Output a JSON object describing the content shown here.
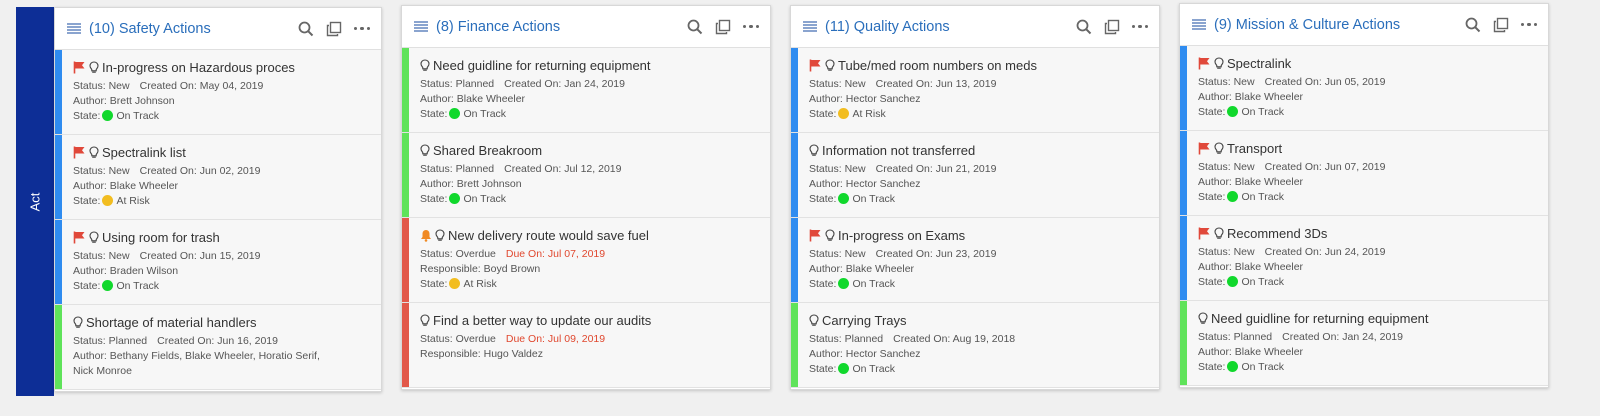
{
  "act_label": "Act",
  "colors": {
    "act_band": "#0d2e96",
    "title_blue": "#2a6ebb",
    "bar_blue": "#2f8cf0",
    "bar_green": "#5fe35a",
    "bar_red": "#e2584a",
    "flag_red": "#e0483a",
    "bell_orange": "#f08a24",
    "state_green": "#10d82c",
    "state_yellow": "#f2bd20",
    "overdue_red": "#e0482f"
  },
  "labels": {
    "status": "Status:",
    "created_on": "Created On:",
    "due_on": "Due On:",
    "author": "Author:",
    "responsible": "Responsible:",
    "state": "State:"
  },
  "boards": [
    {
      "title": "(10) Safety Actions",
      "cards": [
        {
          "title": "In-progress on Hazardous proces",
          "flag": true,
          "bar": "blue",
          "status": "New",
          "created": "May 04, 2019",
          "author": "Brett Johnson",
          "state": "On Track",
          "state_color": "green"
        },
        {
          "title": "Spectralink list",
          "flag": true,
          "bar": "blue",
          "status": "New",
          "created": "Jun 02, 2019",
          "author": "Blake Wheeler",
          "state": "At Risk",
          "state_color": "yellow"
        },
        {
          "title": "Using room for trash",
          "flag": true,
          "bar": "blue",
          "status": "New",
          "created": "Jun 15, 2019",
          "author": "Braden Wilson",
          "state": "On Track",
          "state_color": "green"
        },
        {
          "title": "Shortage of material handlers",
          "flag": false,
          "bar": "green",
          "status": "Planned",
          "created": "Jun 16, 2019",
          "author": "Bethany Fields, Blake Wheeler, Horatio Serif,",
          "author2": "Nick Monroe"
        }
      ]
    },
    {
      "title": "(8) Finance Actions",
      "cards": [
        {
          "title": "Need guidline for returning equipment",
          "flag": false,
          "bar": "green",
          "status": "Planned",
          "created": "Jan 24, 2019",
          "author": "Blake Wheeler",
          "state": "On Track",
          "state_color": "green"
        },
        {
          "title": "Shared Breakroom",
          "flag": false,
          "bar": "green",
          "status": "Planned",
          "created": "Jul 12, 2019",
          "author": "Brett Johnson",
          "state": "On Track",
          "state_color": "green"
        },
        {
          "title": "New delivery route would save fuel",
          "bell": true,
          "bar": "red",
          "status": "Overdue",
          "due": "Jul 07, 2019",
          "responsible": "Boyd Brown",
          "state": "At Risk",
          "state_color": "yellow"
        },
        {
          "title": "Find a better way to update our audits",
          "flag": false,
          "bar": "red",
          "status": "Overdue",
          "due": "Jul 09, 2019",
          "responsible": "Hugo Valdez"
        }
      ]
    },
    {
      "title": "(11) Quality Actions",
      "cards": [
        {
          "title": "Tube/med room numbers on meds",
          "flag": true,
          "bar": "blue",
          "status": "New",
          "created": "Jun 13, 2019",
          "author": "Hector Sanchez",
          "state": "At Risk",
          "state_color": "yellow"
        },
        {
          "title": "Information not transferred",
          "flag": false,
          "bar": "blue",
          "status": "New",
          "created": "Jun 21, 2019",
          "author": "Hector Sanchez",
          "state": "On Track",
          "state_color": "green"
        },
        {
          "title": "In-progress on Exams",
          "flag": true,
          "bar": "blue",
          "status": "New",
          "created": "Jun 23, 2019",
          "author": "Blake Wheeler",
          "state": "On Track",
          "state_color": "green"
        },
        {
          "title": "Carrying Trays",
          "flag": false,
          "bar": "green",
          "status": "Planned",
          "created": "Aug 19, 2018",
          "author": "Hector Sanchez",
          "state": "On Track",
          "state_color": "green"
        }
      ]
    },
    {
      "title": "(9) Mission & Culture Actions",
      "cards": [
        {
          "title": "Spectralink",
          "flag": true,
          "bar": "blue",
          "status": "New",
          "created": "Jun 05, 2019",
          "author": "Blake Wheeler",
          "state": "On Track",
          "state_color": "green"
        },
        {
          "title": "Transport",
          "flag": true,
          "bar": "blue",
          "status": "New",
          "created": "Jun 07, 2019",
          "author": "Blake Wheeler",
          "state": "On Track",
          "state_color": "green"
        },
        {
          "title": "Recommend 3Ds",
          "flag": true,
          "bar": "blue",
          "status": "New",
          "created": "Jun 24, 2019",
          "author": "Blake Wheeler",
          "state": "On Track",
          "state_color": "green"
        },
        {
          "title": "Need guidline for returning equipment",
          "flag": false,
          "bar": "green",
          "status": "Planned",
          "created": "Jan 24, 2019",
          "author": "Blake Wheeler",
          "state": "On Track",
          "state_color": "green"
        }
      ]
    }
  ]
}
